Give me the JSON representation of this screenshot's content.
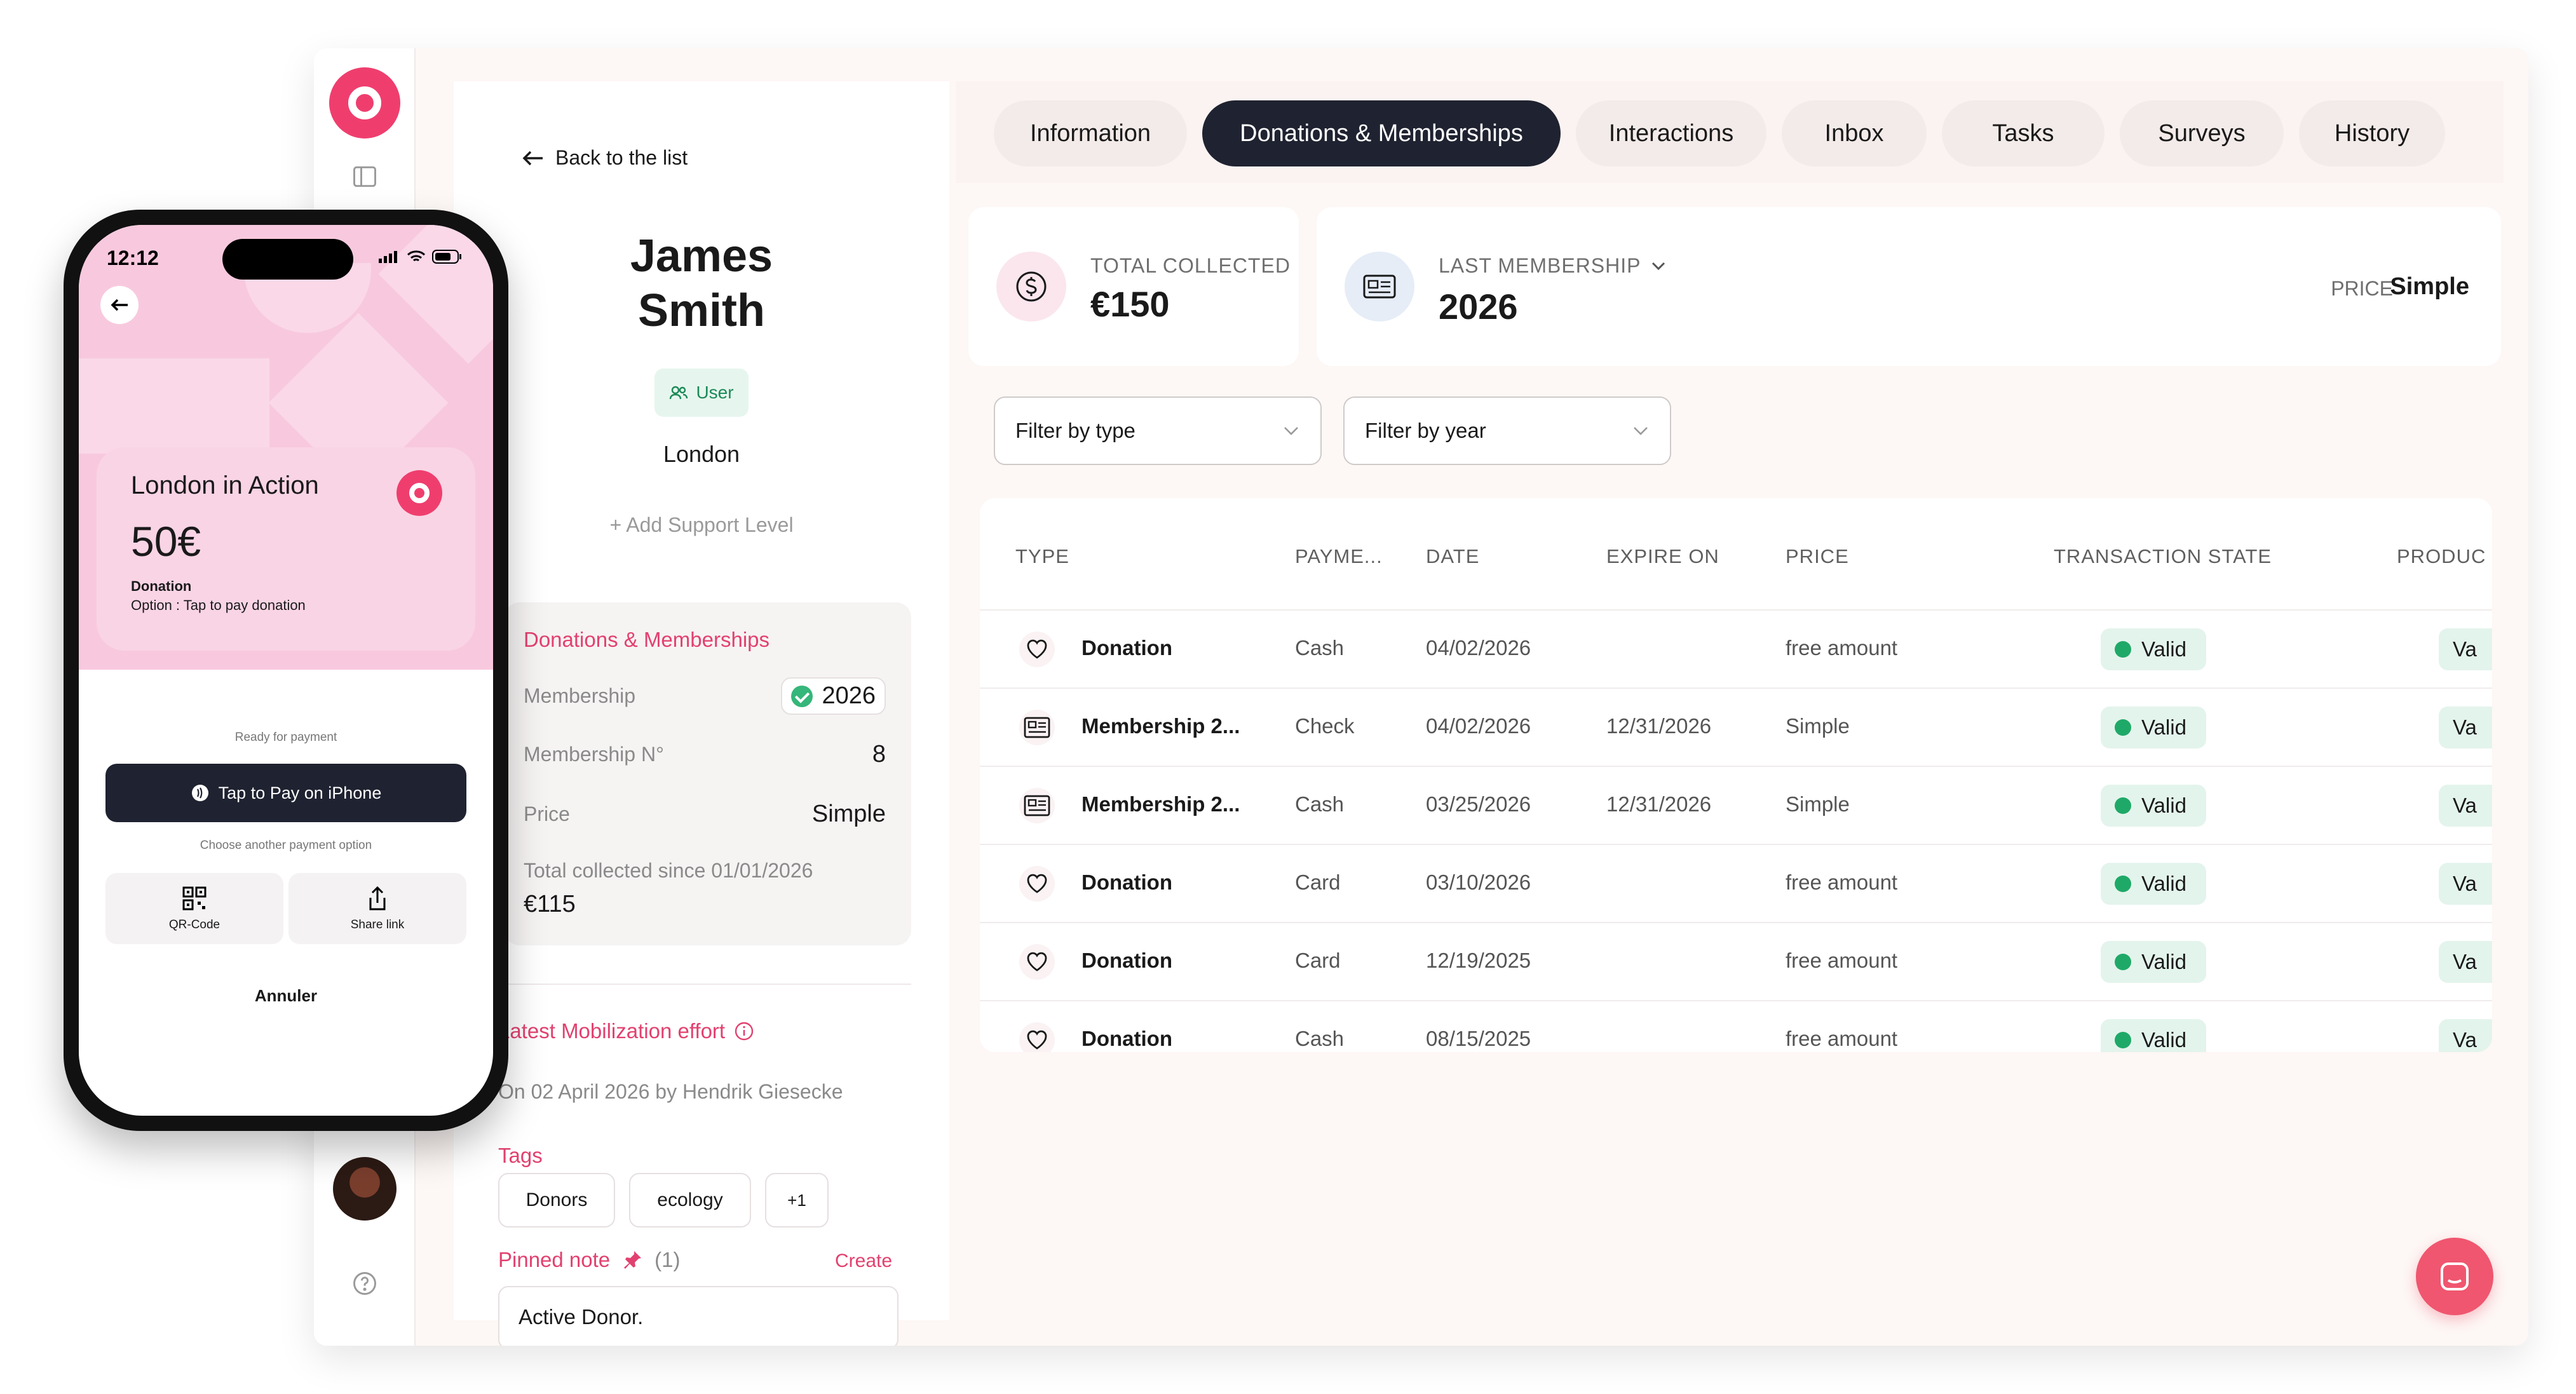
{
  "profile": {
    "back_label": "Back to the list",
    "first_name": "James",
    "last_name": "Smith",
    "badge": "User",
    "city": "London",
    "add_support": "+ Add Support Level",
    "donations": {
      "title": "Donations & Memberships",
      "membership_label": "Membership",
      "membership_value": "2026",
      "membership_no_label": "Membership N°",
      "membership_no_value": "8",
      "price_label": "Price",
      "price_value": "Simple",
      "total_label": "Total collected since 01/01/2026",
      "total_value": "€115"
    },
    "mobilization_title": "Latest Mobilization effort",
    "mobilization_text": "On 02 April 2026 by Hendrik Giesecke",
    "tags_title": "Tags",
    "tags": [
      "Donors",
      "ecology",
      "+1"
    ],
    "pinned_label": "Pinned note",
    "pinned_count": "(1)",
    "create_label": "Create",
    "note_text": "Active Donor."
  },
  "tabs": [
    "Information",
    "Donations & Memberships",
    "Interactions",
    "Inbox",
    "Tasks",
    "Surveys",
    "History"
  ],
  "active_tab": "Donations & Memberships",
  "stats": {
    "total_label": "TOTAL COLLECTED",
    "total_value": "€150",
    "last_label": "LAST MEMBERSHIP",
    "last_value": "2026",
    "price_label": "PRICE",
    "price_value": "Simple"
  },
  "filters": {
    "type": "Filter by type",
    "year": "Filter by year"
  },
  "table": {
    "headers": [
      "TYPE",
      "PAYME...",
      "DATE",
      "EXPIRE ON",
      "PRICE",
      "TRANSACTION STATE",
      "PRODUC"
    ],
    "rows": [
      {
        "icon": "heart-icon",
        "type": "Donation",
        "payment": "Cash",
        "date": "04/02/2026",
        "expire": "",
        "price": "free amount",
        "state": "Valid",
        "product": "Va"
      },
      {
        "icon": "card-icon",
        "type": "Membership 2...",
        "payment": "Check",
        "date": "04/02/2026",
        "expire": "12/31/2026",
        "price": "Simple",
        "state": "Valid",
        "product": "Va"
      },
      {
        "icon": "card-icon",
        "type": "Membership 2...",
        "payment": "Cash",
        "date": "03/25/2026",
        "expire": "12/31/2026",
        "price": "Simple",
        "state": "Valid",
        "product": "Va"
      },
      {
        "icon": "heart-icon",
        "type": "Donation",
        "payment": "Card",
        "date": "03/10/2026",
        "expire": "",
        "price": "free amount",
        "state": "Valid",
        "product": "Va"
      },
      {
        "icon": "heart-icon",
        "type": "Donation",
        "payment": "Card",
        "date": "12/19/2025",
        "expire": "",
        "price": "free amount",
        "state": "Valid",
        "product": "Va"
      },
      {
        "icon": "heart-icon",
        "type": "Donation",
        "payment": "Cash",
        "date": "08/15/2025",
        "expire": "",
        "price": "free amount",
        "state": "Valid",
        "product": "Va"
      }
    ]
  },
  "phone": {
    "time": "12:12",
    "org": "London in Action",
    "amount": "50€",
    "type": "Donation",
    "option": "Option : Tap to pay donation",
    "ready": "Ready for payment",
    "pay_button": "Tap to Pay on iPhone",
    "choose": "Choose another payment option",
    "qr": "QR-Code",
    "share": "Share link",
    "cancel": "Annuler"
  },
  "colors": {
    "accent": "#ef3e6e",
    "dark": "#1f2230",
    "valid": "#1fa968",
    "phone_bg": "#f8c9de"
  }
}
